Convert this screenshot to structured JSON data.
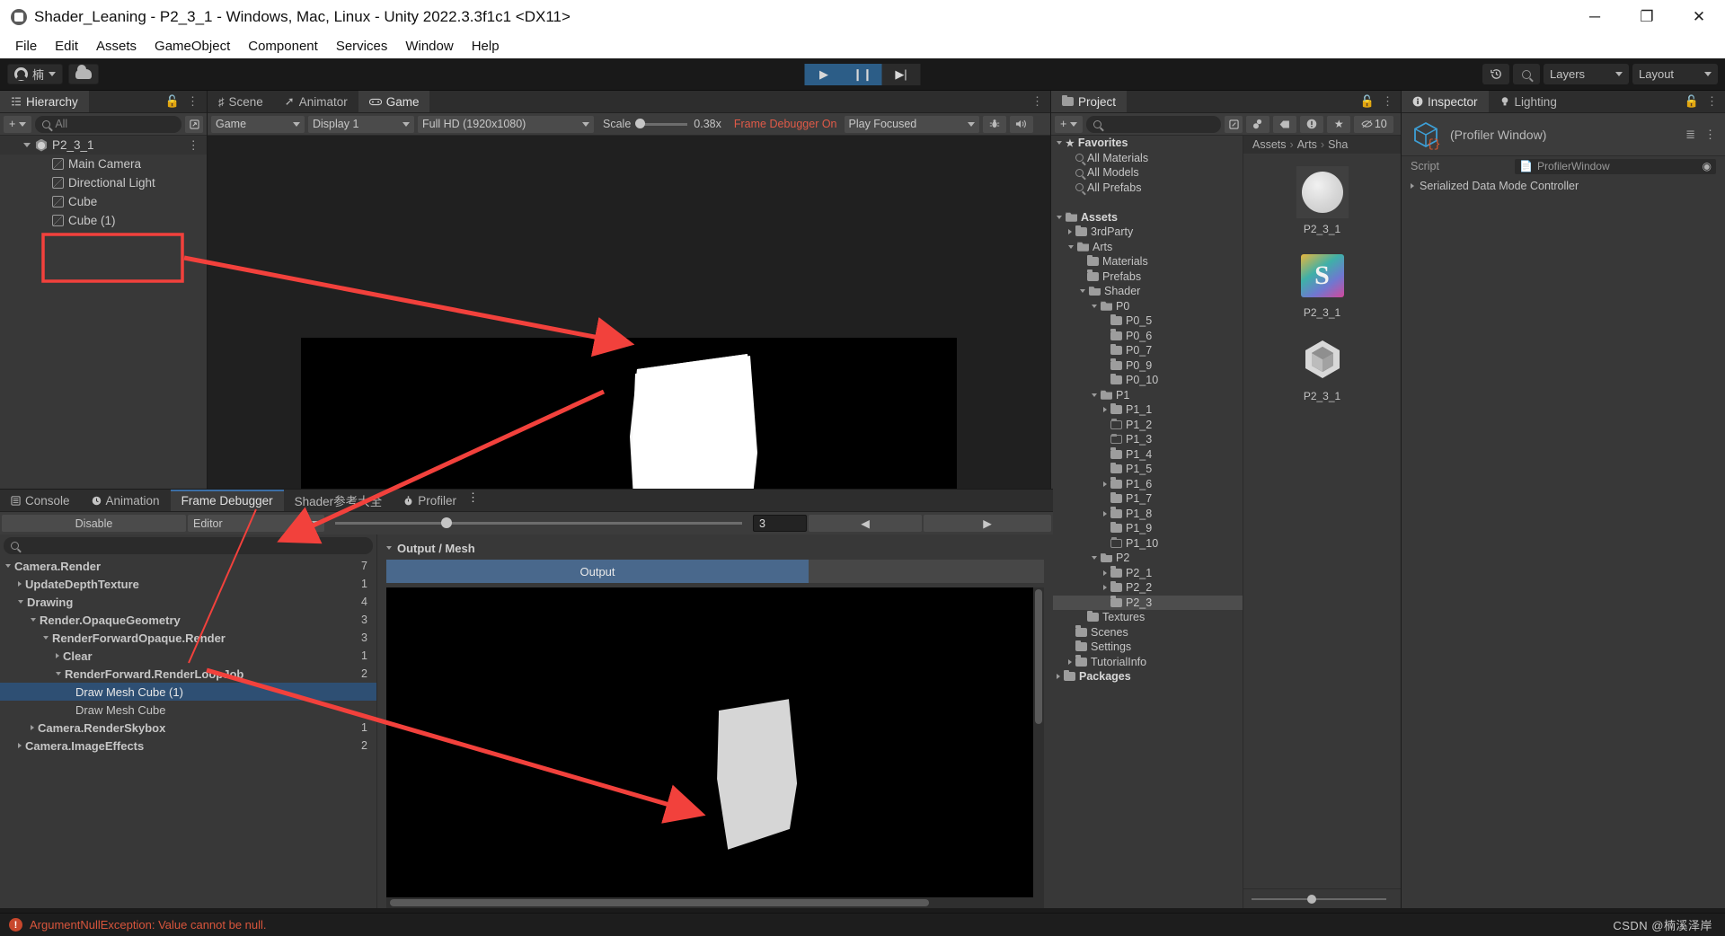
{
  "window": {
    "title": "Shader_Leaning - P2_3_1 - Windows, Mac, Linux - Unity 2022.3.3f1c1 <DX11>",
    "minimize": "─",
    "maximize": "❐",
    "close": "✕"
  },
  "menu": [
    "File",
    "Edit",
    "Assets",
    "GameObject",
    "Component",
    "Services",
    "Window",
    "Help"
  ],
  "toolbar": {
    "account_label": "楠",
    "cloud_icon": "cloud-icon",
    "play": "▶",
    "pause": "❙❙",
    "step": "▶|",
    "history_icon": "history-icon",
    "search_icon": "search-icon",
    "layers": "Layers",
    "layout": "Layout"
  },
  "hierarchy": {
    "tab": "Hierarchy",
    "add_label": "+",
    "search_placeholder": "All",
    "items": [
      {
        "label": "P2_3_1",
        "indent": 0,
        "icon": "unity-logo",
        "expanded": true,
        "root": true
      },
      {
        "label": "Main Camera",
        "indent": 1,
        "icon": "cube-icon"
      },
      {
        "label": "Directional Light",
        "indent": 1,
        "icon": "cube-icon"
      },
      {
        "label": "Cube",
        "indent": 1,
        "icon": "cube-icon"
      },
      {
        "label": "Cube (1)",
        "indent": 1,
        "icon": "cube-icon"
      }
    ]
  },
  "gameview": {
    "tabs": [
      {
        "label": "Scene",
        "icon": "grid-icon",
        "active": false
      },
      {
        "label": "Animator",
        "icon": "animator-icon",
        "active": false
      },
      {
        "label": "Game",
        "icon": "gamepad-icon",
        "active": true
      }
    ],
    "mode": "Game",
    "display": "Display 1",
    "resolution": "Full HD (1920x1080)",
    "scale_label": "Scale",
    "scale_value": "0.38x",
    "frame_debugger_status": "Frame Debugger On",
    "play_focus": "Play Focused",
    "stats_icon": "bug-icon",
    "mute_icon": "audio-icon"
  },
  "project": {
    "tab": "Project",
    "search_placeholder": "",
    "hidden_count": "10",
    "breadcrumb": [
      "Assets",
      "Arts",
      "Sha"
    ],
    "tree": [
      {
        "label": "Favorites",
        "indent": 0,
        "icon": "star",
        "arrow": "open",
        "bold": true
      },
      {
        "label": "All Materials",
        "indent": 1,
        "icon": "search",
        "arrow": "none"
      },
      {
        "label": "All Models",
        "indent": 1,
        "icon": "search",
        "arrow": "none"
      },
      {
        "label": "All Prefabs",
        "indent": 1,
        "icon": "search",
        "arrow": "none"
      },
      {
        "label": "",
        "indent": 0,
        "icon": "spacer",
        "arrow": "none"
      },
      {
        "label": "Assets",
        "indent": 0,
        "icon": "folder-open",
        "arrow": "open",
        "bold": true
      },
      {
        "label": "3rdParty",
        "indent": 1,
        "icon": "folder",
        "arrow": "closed"
      },
      {
        "label": "Arts",
        "indent": 1,
        "icon": "folder-open",
        "arrow": "open"
      },
      {
        "label": "Materials",
        "indent": 2,
        "icon": "folder",
        "arrow": "none"
      },
      {
        "label": "Prefabs",
        "indent": 2,
        "icon": "folder",
        "arrow": "none"
      },
      {
        "label": "Shader",
        "indent": 2,
        "icon": "folder-open",
        "arrow": "open"
      },
      {
        "label": "P0",
        "indent": 3,
        "icon": "folder-open",
        "arrow": "open"
      },
      {
        "label": "P0_5",
        "indent": 4,
        "icon": "folder",
        "arrow": "none"
      },
      {
        "label": "P0_6",
        "indent": 4,
        "icon": "folder",
        "arrow": "none"
      },
      {
        "label": "P0_7",
        "indent": 4,
        "icon": "folder",
        "arrow": "none"
      },
      {
        "label": "P0_9",
        "indent": 4,
        "icon": "folder",
        "arrow": "none"
      },
      {
        "label": "P0_10",
        "indent": 4,
        "icon": "folder",
        "arrow": "none"
      },
      {
        "label": "P1",
        "indent": 3,
        "icon": "folder-open",
        "arrow": "open"
      },
      {
        "label": "P1_1",
        "indent": 4,
        "icon": "folder",
        "arrow": "closed"
      },
      {
        "label": "P1_2",
        "indent": 4,
        "icon": "folder-empty",
        "arrow": "none"
      },
      {
        "label": "P1_3",
        "indent": 4,
        "icon": "folder-empty",
        "arrow": "none"
      },
      {
        "label": "P1_4",
        "indent": 4,
        "icon": "folder",
        "arrow": "none"
      },
      {
        "label": "P1_5",
        "indent": 4,
        "icon": "folder",
        "arrow": "none"
      },
      {
        "label": "P1_6",
        "indent": 4,
        "icon": "folder",
        "arrow": "closed"
      },
      {
        "label": "P1_7",
        "indent": 4,
        "icon": "folder",
        "arrow": "none"
      },
      {
        "label": "P1_8",
        "indent": 4,
        "icon": "folder",
        "arrow": "closed"
      },
      {
        "label": "P1_9",
        "indent": 4,
        "icon": "folder",
        "arrow": "none"
      },
      {
        "label": "P1_10",
        "indent": 4,
        "icon": "folder-empty",
        "arrow": "none"
      },
      {
        "label": "P2",
        "indent": 3,
        "icon": "folder-open",
        "arrow": "open"
      },
      {
        "label": "P2_1",
        "indent": 4,
        "icon": "folder",
        "arrow": "closed"
      },
      {
        "label": "P2_2",
        "indent": 4,
        "icon": "folder",
        "arrow": "closed"
      },
      {
        "label": "P2_3",
        "indent": 4,
        "icon": "folder",
        "arrow": "none",
        "selected": true
      },
      {
        "label": "Textures",
        "indent": 2,
        "icon": "folder",
        "arrow": "none"
      },
      {
        "label": "Scenes",
        "indent": 1,
        "icon": "folder",
        "arrow": "none"
      },
      {
        "label": "Settings",
        "indent": 1,
        "icon": "folder",
        "arrow": "none"
      },
      {
        "label": "TutorialInfo",
        "indent": 1,
        "icon": "folder",
        "arrow": "closed"
      },
      {
        "label": "Packages",
        "indent": 0,
        "icon": "folder",
        "arrow": "closed",
        "bold": true
      }
    ],
    "assets": [
      {
        "name": "P2_3_1",
        "kind": "material"
      },
      {
        "name": "P2_3_1",
        "kind": "shader"
      },
      {
        "name": "P2_3_1",
        "kind": "prefab"
      }
    ]
  },
  "inspector": {
    "tabs": [
      {
        "label": "Inspector",
        "icon": "info-icon",
        "active": true
      },
      {
        "label": "Lighting",
        "icon": "bulb-icon",
        "active": false
      }
    ],
    "object_title": "(Profiler Window)",
    "script_label": "Script",
    "script_value": "ProfilerWindow",
    "serialized_row": "Serialized Data Mode Controller"
  },
  "framedebugger": {
    "tabs": [
      {
        "label": "Console",
        "icon": "console-icon",
        "active": false
      },
      {
        "label": "Animation",
        "icon": "clock-icon",
        "active": false
      },
      {
        "label": "Frame Debugger",
        "icon": "",
        "active": true
      },
      {
        "label": "Shader参考大全",
        "icon": "",
        "active": false
      },
      {
        "label": "Profiler",
        "icon": "stopwatch-icon",
        "active": false
      }
    ],
    "disable_button": "Disable",
    "target_dropdown": "Editor",
    "frame_index": "3",
    "prev_button": "◀",
    "next_button": "▶",
    "search_placeholder": "",
    "tree": [
      {
        "label": "Camera.Render",
        "count": "7",
        "indent": 0,
        "arrow": "open",
        "bold": true
      },
      {
        "label": "UpdateDepthTexture",
        "count": "1",
        "indent": 1,
        "arrow": "closed",
        "bold": true
      },
      {
        "label": "Drawing",
        "count": "4",
        "indent": 1,
        "arrow": "open",
        "bold": true
      },
      {
        "label": "Render.OpaqueGeometry",
        "count": "3",
        "indent": 2,
        "arrow": "open",
        "bold": true
      },
      {
        "label": "RenderForwardOpaque.Render",
        "count": "3",
        "indent": 3,
        "arrow": "open",
        "bold": true
      },
      {
        "label": "Clear",
        "count": "1",
        "indent": 4,
        "arrow": "closed",
        "bold": true
      },
      {
        "label": "RenderForward.RenderLoopJob",
        "count": "2",
        "indent": 4,
        "arrow": "open",
        "bold": true
      },
      {
        "label": "Draw Mesh Cube (1)",
        "count": "",
        "indent": 5,
        "arrow": "none",
        "selected": true
      },
      {
        "label": "Draw Mesh Cube",
        "count": "",
        "indent": 5,
        "arrow": "none"
      },
      {
        "label": "Camera.RenderSkybox",
        "count": "1",
        "indent": 2,
        "arrow": "closed",
        "bold": true
      },
      {
        "label": "Camera.ImageEffects",
        "count": "2",
        "indent": 1,
        "arrow": "closed",
        "bold": true
      }
    ],
    "output_mesh_header": "Output / Mesh",
    "output_tab": "Output",
    "mesh_tab": ""
  },
  "statusbar": {
    "message": "ArgumentNullException: Value cannot be null.",
    "error_icon": "error-icon",
    "watermark": "CSDN @楠溪泽岸"
  },
  "colors": {
    "accent_blue": "#2c5d87",
    "selection_blue": "#2e4f73",
    "annotation_red": "#f2413c",
    "error_red": "#d8553c",
    "panel_bg": "#383838"
  }
}
